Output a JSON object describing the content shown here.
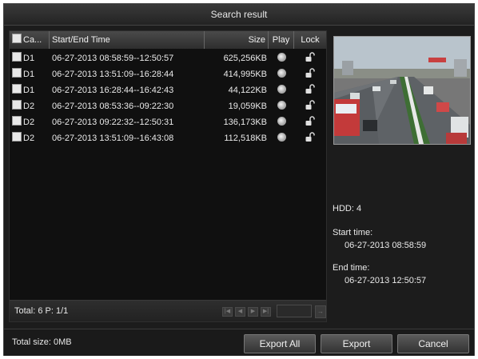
{
  "window": {
    "title": "Search result"
  },
  "table": {
    "headers": {
      "channel": "Ca...",
      "time": "Start/End Time",
      "size": "Size",
      "play": "Play",
      "lock": "Lock"
    },
    "rows": [
      {
        "channel": "D1",
        "time": "06-27-2013 08:58:59--12:50:57",
        "size": "625,256KB"
      },
      {
        "channel": "D1",
        "time": "06-27-2013 13:51:09--16:28:44",
        "size": "414,995KB"
      },
      {
        "channel": "D1",
        "time": "06-27-2013 16:28:44--16:42:43",
        "size": "44,122KB"
      },
      {
        "channel": "D2",
        "time": "06-27-2013 08:53:36--09:22:30",
        "size": "19,059KB"
      },
      {
        "channel": "D2",
        "time": "06-27-2013 09:22:32--12:50:31",
        "size": "136,173KB"
      },
      {
        "channel": "D2",
        "time": "06-27-2013 13:51:09--16:43:08",
        "size": "112,518KB"
      }
    ]
  },
  "list_footer": {
    "total": "Total: 6  P: 1/1"
  },
  "details": {
    "hdd": "HDD: 4",
    "start_label": "Start time:",
    "start_value": "06-27-2013 08:58:59",
    "end_label": "End time:",
    "end_value": "06-27-2013 12:50:57"
  },
  "bottom": {
    "total_size": "Total size: 0MB",
    "export_all": "Export All",
    "export": "Export",
    "cancel": "Cancel"
  },
  "icons": {
    "play": "play-icon",
    "lock": "unlock-icon"
  },
  "colors": {
    "background": "#1c1c1c",
    "header": "#3a3a3a",
    "text": "#eaeaea"
  }
}
